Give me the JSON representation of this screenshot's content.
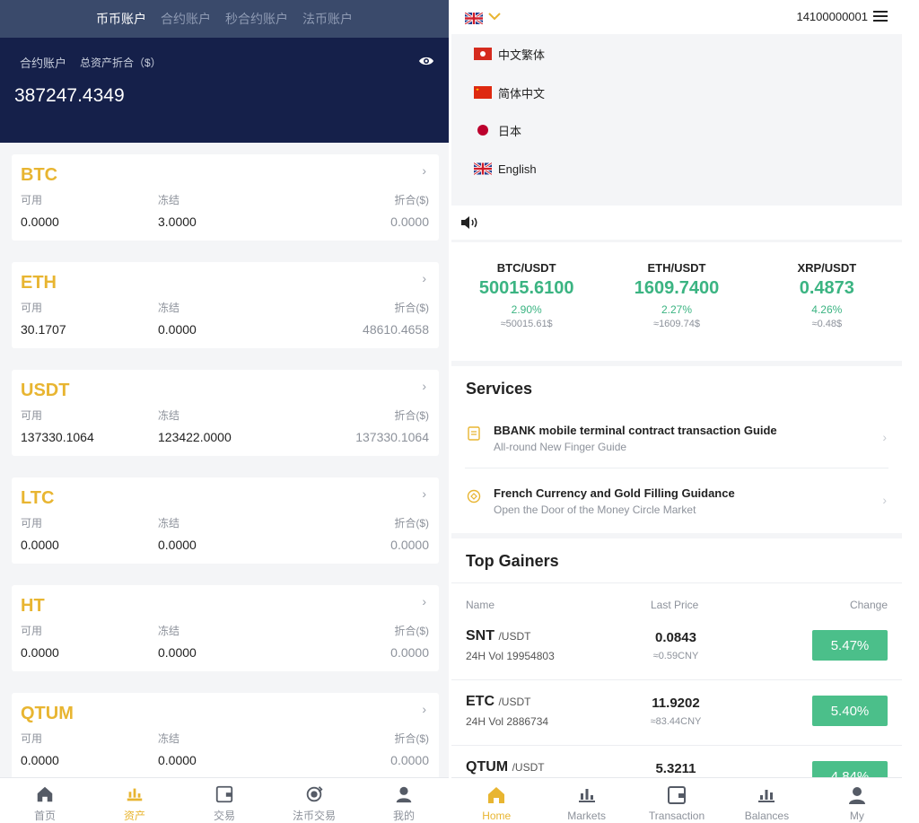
{
  "left": {
    "tabs": [
      "币币账户",
      "合约账户",
      "秒合约账户",
      "法币账户"
    ],
    "active_tab": 0,
    "summary": {
      "label": "合约账户",
      "label2": "总资产折合（$）",
      "total": "387247.4349"
    },
    "column_labels": {
      "available": "可用",
      "frozen": "冻结",
      "converted": "折合($)"
    },
    "assets": [
      {
        "symbol": "BTC",
        "available": "0.0000",
        "frozen": "3.0000",
        "converted": "0.0000"
      },
      {
        "symbol": "ETH",
        "available": "30.1707",
        "frozen": "0.0000",
        "converted": "48610.4658"
      },
      {
        "symbol": "USDT",
        "available": "137330.1064",
        "frozen": "123422.0000",
        "converted": "137330.1064"
      },
      {
        "symbol": "LTC",
        "available": "0.0000",
        "frozen": "0.0000",
        "converted": "0.0000"
      },
      {
        "symbol": "HT",
        "available": "0.0000",
        "frozen": "0.0000",
        "converted": "0.0000"
      },
      {
        "symbol": "QTUM",
        "available": "0.0000",
        "frozen": "0.0000",
        "converted": "0.0000"
      }
    ],
    "nav": [
      {
        "label": "首页",
        "icon": "home-icon"
      },
      {
        "label": "资产",
        "icon": "assets-icon"
      },
      {
        "label": "交易",
        "icon": "wallet-icon"
      },
      {
        "label": "法币交易",
        "icon": "fiat-icon"
      },
      {
        "label": "我的",
        "icon": "user-icon"
      }
    ],
    "active_nav": 1
  },
  "right": {
    "account": "14100000001",
    "languages": [
      {
        "label": "中文繁体",
        "flag": "hongkong-flag-icon"
      },
      {
        "label": "简体中文",
        "flag": "china-flag-icon"
      },
      {
        "label": "日本",
        "flag": "japan-flag-icon"
      },
      {
        "label": "English",
        "flag": "uk-flag-icon"
      }
    ],
    "tickers": [
      {
        "pair": "BTC/USDT",
        "price": "50015.6100",
        "pct": "2.90%",
        "approx": "≈50015.61$"
      },
      {
        "pair": "ETH/USDT",
        "price": "1609.7400",
        "pct": "2.27%",
        "approx": "≈1609.74$"
      },
      {
        "pair": "XRP/USDT",
        "price": "0.4873",
        "pct": "4.26%",
        "approx": "≈0.48$"
      }
    ],
    "services": {
      "title": "Services",
      "items": [
        {
          "title": "BBANK mobile terminal contract transaction Guide",
          "subtitle": "All-round New Finger Guide"
        },
        {
          "title": "French Currency and Gold Filling Guidance",
          "subtitle": "Open the Door of the Money Circle Market"
        }
      ]
    },
    "gainers": {
      "title": "Top Gainers",
      "headers": {
        "name": "Name",
        "price": "Last Price",
        "change": "Change"
      },
      "rows": [
        {
          "symbol": "SNT",
          "quote": "/USDT",
          "vol": "24H Vol 19954803",
          "price": "0.0843",
          "cny": "≈0.59CNY",
          "change": "5.47%"
        },
        {
          "symbol": "ETC",
          "quote": "/USDT",
          "vol": "24H Vol 2886734",
          "price": "11.9202",
          "cny": "≈83.44CNY",
          "change": "5.40%"
        },
        {
          "symbol": "QTUM",
          "quote": "/USDT",
          "vol": "",
          "price": "5.3211",
          "cny": "",
          "change": "4.84%"
        }
      ]
    },
    "nav": [
      {
        "label": "Home",
        "icon": "home-icon"
      },
      {
        "label": "Markets",
        "icon": "markets-icon"
      },
      {
        "label": "Transaction",
        "icon": "wallet-icon"
      },
      {
        "label": "Balances",
        "icon": "balances-icon"
      },
      {
        "label": "My",
        "icon": "user-icon"
      }
    ],
    "active_nav": 0
  },
  "colors": {
    "accent": "#e8b531",
    "up": "#3bb482",
    "header_dark": "#15204a",
    "tabs_bg": "#3a4a6b"
  }
}
